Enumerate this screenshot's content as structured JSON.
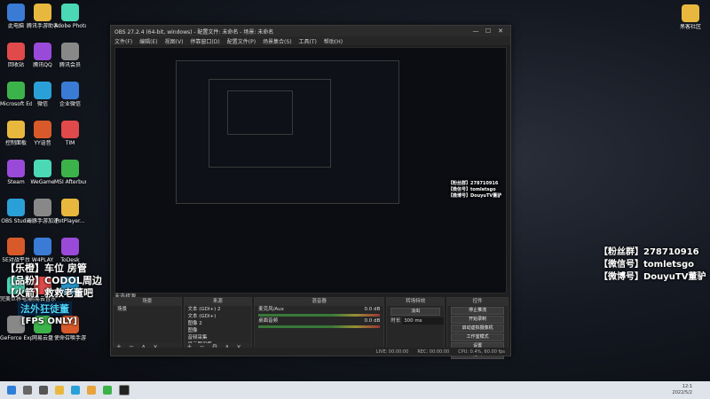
{
  "desktop": {
    "icons_col1": [
      "此电脑",
      "回收站",
      "Microsoft Edge",
      "控制面板",
      "Steam",
      "OBS Studio",
      "5E对战平台",
      "完美世界电竞",
      "GeForce Experience"
    ],
    "icons_col2": [
      "腾讯手游助手",
      "腾讯QQ",
      "微信",
      "YY语音",
      "WeGame",
      "海豚手游加速器5.0",
      "W4PLAY",
      "网易云音乐",
      "网易云盘"
    ],
    "icons_col3": [
      "Adobe Photosh...",
      "腾讯会员",
      "企业微信",
      "TIM",
      "MSI Afterburner",
      "PotPlayer...",
      "ToDesk",
      "",
      "使命召唤手游"
    ],
    "right_icon": "黑客社区"
  },
  "overlay_left": {
    "line1": "【乐橙】车位 房管",
    "line2": "【品粉】CODOL周边",
    "line3": "【火箭】救救老董吧",
    "tag1": "法外狂徒董",
    "tag2": "[FPS ONLY]"
  },
  "overlay_right": {
    "line1": "【粉丝群】278710916",
    "line2": "【微信号】tomletsgo",
    "line3": "【微博号】DouyuTV董驴"
  },
  "obs": {
    "title": "OBS 27.2.4 (64-bit, windows) - 配置文件: 未命名 - 场景: 未命名",
    "menu": [
      "文件(F)",
      "编辑(E)",
      "视图(V)",
      "停靠窗口(D)",
      "配置文件(P)",
      "场景集合(S)",
      "工具(T)",
      "帮助(H)"
    ],
    "status_label": "未选择源",
    "docks": {
      "scenes": {
        "title": "场景",
        "items": [
          "场景"
        ]
      },
      "sources": {
        "title": "来源",
        "items": [
          "文本 (GDI+) 2",
          "文本 (GDI+)",
          "图像 2",
          "图像",
          "音频采集",
          "显示器采集"
        ]
      },
      "mixer": {
        "title": "混音器",
        "channels": [
          {
            "name": "麦克风/Aux",
            "db": "0.0 dB"
          },
          {
            "name": "桌面音频",
            "db": "0.0 dB"
          }
        ]
      },
      "transitions": {
        "title": "转场特效",
        "type": "淡出",
        "duration_label": "时长",
        "duration": "300 ms"
      },
      "controls": {
        "title": "控件",
        "buttons": [
          "停止推流",
          "开始录制",
          "启动虚拟摄像机",
          "工作室模式",
          "设置",
          "退出"
        ]
      }
    },
    "statusbar": {
      "live": "LIVE: 00:00:00",
      "rec": "REC: 00:00:00",
      "cpu": "CPU: 0.4%, 60.00 fps"
    }
  },
  "taskbar": {
    "time": "12:1",
    "date": "2022/5/2"
  },
  "colors": {
    "obs_bg": "#1f1f1f",
    "accent": "#3c8c3c",
    "taskbar": "#dfe3ea"
  }
}
